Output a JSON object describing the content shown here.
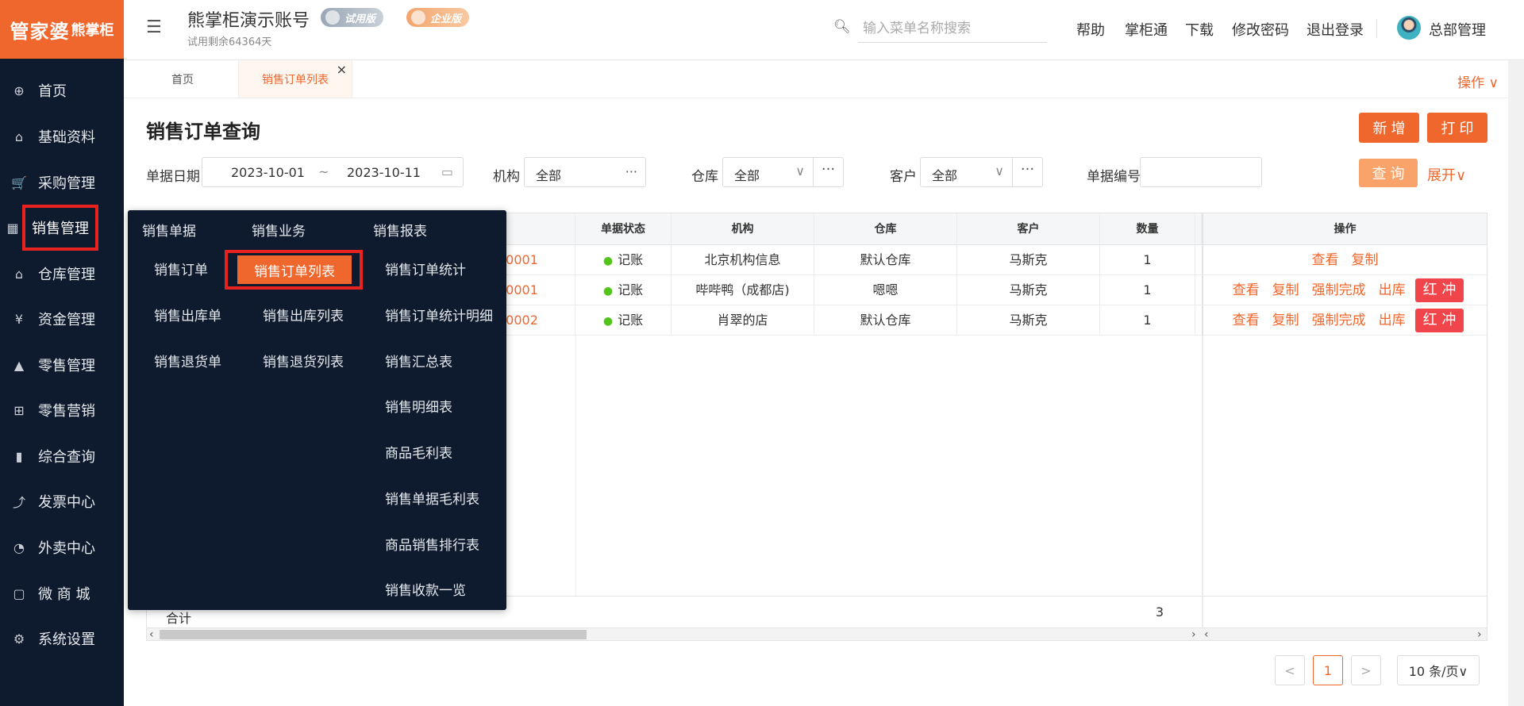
{
  "brand": {
    "logo_main": "管家婆",
    "logo_sub": "熊掌柜",
    "color": "#f0672d"
  },
  "sidebar": {
    "items": [
      {
        "label": "首页",
        "icon": "globe-icon",
        "glyph": "⊕"
      },
      {
        "label": "基础资料",
        "icon": "home-icon",
        "glyph": "⌂"
      },
      {
        "label": "采购管理",
        "icon": "cart-icon",
        "glyph": "🛒"
      },
      {
        "label": "销售管理",
        "icon": "sales-icon",
        "glyph": "▦"
      },
      {
        "label": "仓库管理",
        "icon": "warehouse-icon",
        "glyph": "⌂"
      },
      {
        "label": "资金管理",
        "icon": "money-icon",
        "glyph": "¥"
      },
      {
        "label": "零售管理",
        "icon": "retail-chart-icon",
        "glyph": "▲"
      },
      {
        "label": "零售营销",
        "icon": "gift-icon",
        "glyph": "⊞"
      },
      {
        "label": "综合查询",
        "icon": "bar-chart-icon",
        "glyph": "▮"
      },
      {
        "label": "发票中心",
        "icon": "invoice-icon",
        "glyph": "⤴"
      },
      {
        "label": "外卖中心",
        "icon": "delivery-icon",
        "glyph": "◔"
      },
      {
        "label": "微 商 城",
        "icon": "shop-bag-icon",
        "glyph": "▢"
      },
      {
        "label": "系统设置",
        "icon": "gear-icon",
        "glyph": "⚙"
      }
    ]
  },
  "header": {
    "account_title": "熊掌柜演示账号",
    "trial_left": "试用剩余64364天",
    "badge_trial": "试用版",
    "badge_enterprise": "企业版",
    "search_placeholder": "输入菜单名称搜索",
    "links": [
      "帮助",
      "掌柜通",
      "下载",
      "修改密码",
      "退出登录"
    ],
    "user_name": "总部管理"
  },
  "tabs": {
    "home": "首页",
    "active": "销售订单列表",
    "close": "×",
    "ops": "操作 ∨"
  },
  "page": {
    "title": "销售订单查询",
    "btn_new": "新 增",
    "btn_print": "打 印",
    "filters": {
      "date_label": "单据日期",
      "date_from": "2023-10-01",
      "date_sep": "~",
      "date_to": "2023-10-11",
      "org_label": "机构",
      "org_value": "全部",
      "wh_label": "仓库",
      "wh_value": "全部",
      "cust_label": "客户",
      "cust_value": "全部",
      "no_label": "单据编号",
      "no_value": "",
      "query": "查 询",
      "expand": "展开∨",
      "dots": "···"
    }
  },
  "table": {
    "headers": [
      "单据状态",
      "机构",
      "仓库",
      "客户",
      "数量",
      "操作"
    ],
    "rows": [
      {
        "order": "00001",
        "status": "记账",
        "org": "北京机构信息",
        "wh": "默认仓库",
        "cust": "马斯克",
        "qty": "1",
        "ops": [
          "查看",
          "复制"
        ],
        "red": ""
      },
      {
        "order": "00001",
        "status": "记账",
        "org": "哔哔鸭（成都店)",
        "wh": "嗯嗯",
        "cust": "马斯克",
        "qty": "1",
        "ops": [
          "查看",
          "复制",
          "强制完成",
          "出库"
        ],
        "red": "红 冲"
      },
      {
        "order": "00002",
        "status": "记账",
        "org": "肖翠的店",
        "wh": "默认仓库",
        "cust": "马斯克",
        "qty": "1",
        "ops": [
          "查看",
          "复制",
          "强制完成",
          "出库"
        ],
        "red": "红 冲"
      }
    ],
    "sum_label": "合计",
    "sum_qty": "3"
  },
  "pagination": {
    "prev": "<",
    "page": "1",
    "next": ">",
    "size": "10 条/页∨"
  },
  "dropdown": {
    "col1_head": "销售单据",
    "col2_head": "销售业务",
    "col3_head": "销售报表",
    "col1": [
      "销售订单",
      "销售出库单",
      "销售退货单"
    ],
    "col2": [
      "销售订单列表",
      "销售出库列表",
      "销售退货列表"
    ],
    "col3": [
      "销售订单统计",
      "销售订单统计明细",
      "销售汇总表",
      "销售明细表",
      "商品毛利表",
      "销售单据毛利表",
      "商品销售排行表",
      "销售收款一览"
    ]
  }
}
